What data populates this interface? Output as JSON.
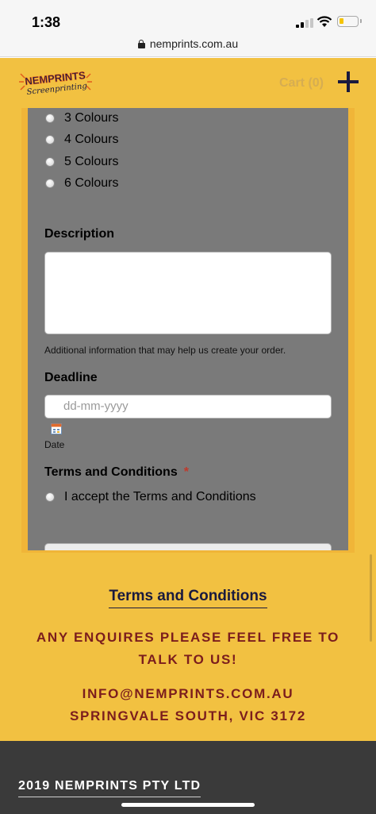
{
  "status": {
    "time": "1:38"
  },
  "browser": {
    "url": "nemprints.com.au"
  },
  "header": {
    "logo_line1": "NEMPRINTS",
    "logo_line2": "Screenprinting",
    "cart_label": "Cart (0)"
  },
  "form": {
    "colour_options": [
      "3 Colours",
      "4 Colours",
      "5 Colours",
      "6 Colours"
    ],
    "description_label": "Description",
    "description_hint": "Additional information that may help us create your order.",
    "deadline_label": "Deadline",
    "deadline_placeholder": "dd-mm-yyyy",
    "deadline_sublabel": "Date",
    "terms_label": "Terms and Conditions",
    "terms_required_marker": "*",
    "terms_checkbox_label": "I accept the Terms and Conditions"
  },
  "footer_info": {
    "terms_link": "Terms and Conditions",
    "enquiry_text": "ANY ENQUIRES PLEASE FEEL FREE TO TALK TO US!",
    "email": "INFO@NEMPRINTS.COM.AU",
    "address": "SPRINGVALE SOUTH, VIC 3172"
  },
  "footer": {
    "copyright": "2019 NEMPRINTS PTY LTD"
  },
  "colors": {
    "page_bg": "#f2c141",
    "form_bg": "#7a7a7a",
    "navy": "#1a1a3e",
    "maroon": "#7b1d1d",
    "footer_bg": "#3a3a3a"
  }
}
